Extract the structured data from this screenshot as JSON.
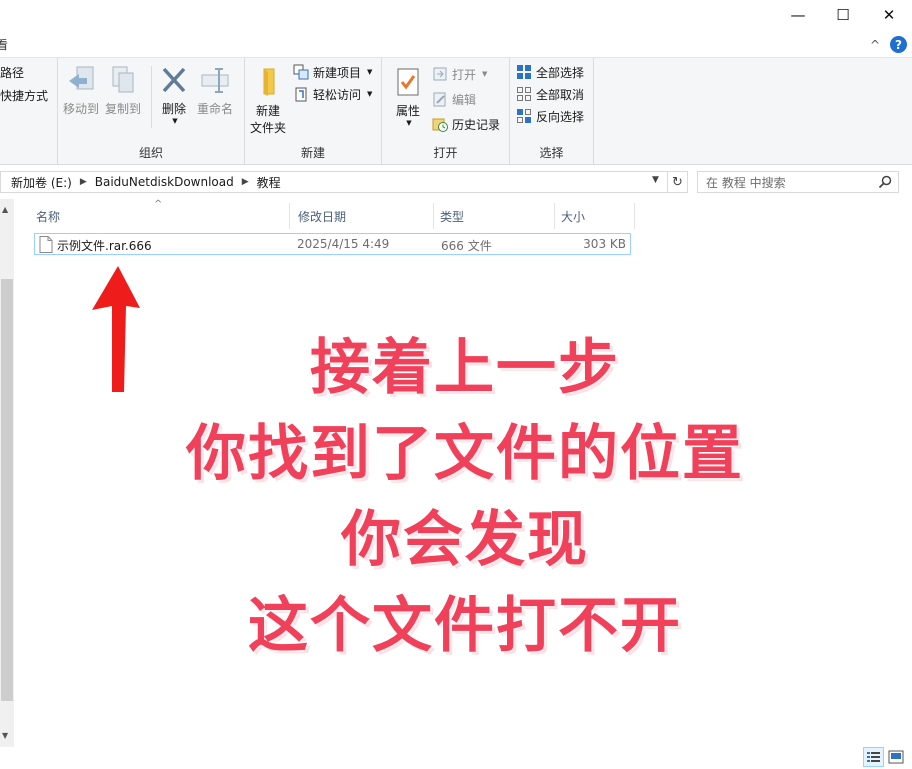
{
  "window": {
    "minimize_glyph": "—",
    "maximize_glyph": "☐",
    "close_glyph": "✕"
  },
  "ribbon_tabs": {
    "partial_tab": "看"
  },
  "ribbon": {
    "clipboard_partial": {
      "copy_path": "路径",
      "paste_shortcut": "快捷方式"
    },
    "organize": {
      "label": "组织",
      "move_to": "移动到",
      "copy_to": "复制到",
      "delete": "删除",
      "rename": "重命名"
    },
    "new": {
      "label": "新建",
      "new_folder_line1": "新建",
      "new_folder_line2": "文件夹",
      "new_item": "新建项目",
      "easy_access": "轻松访问"
    },
    "open": {
      "label": "打开",
      "properties": "属性",
      "open": "打开",
      "edit": "编辑",
      "history": "历史记录"
    },
    "select": {
      "label": "选择",
      "select_all": "全部选择",
      "select_none": "全部取消",
      "invert_selection": "反向选择"
    }
  },
  "address": {
    "crumbs": [
      "新加卷 (E:)",
      "BaiduNetdiskDownload",
      "教程"
    ],
    "search_placeholder": "在 教程 中搜索"
  },
  "columns": {
    "name": "名称",
    "modified": "修改日期",
    "type": "类型",
    "size": "大小"
  },
  "files": [
    {
      "name": "示例文件.rar.666",
      "modified": "2025/4/15 4:49",
      "type": "666 文件",
      "size": "303 KB"
    }
  ],
  "overlay": {
    "lines": [
      "接着上一步",
      "你找到了文件的位置",
      "你会发现",
      "这个文件打不开"
    ],
    "color": "#f0405a"
  },
  "colors": {
    "accent": "#1e6fd1",
    "selection_border": "#99d1ff"
  }
}
